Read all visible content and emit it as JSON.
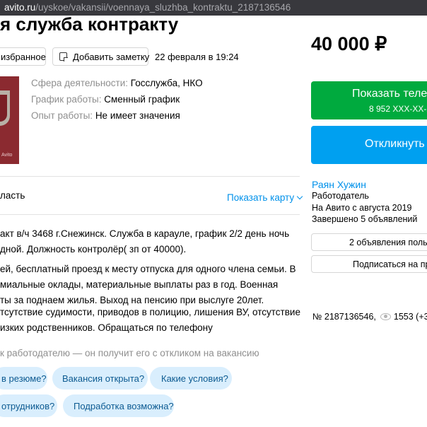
{
  "browser": {
    "url_host": "avito.ru",
    "url_path": "/uyskoe/vakansii/voennaya_sluzhba_kontraktu_2187136546"
  },
  "listing": {
    "title": "я служба контракту",
    "price": "40 000 ₽",
    "favorite_label": "избранное",
    "note_label": "Добавить заметку",
    "posted": "22 февраля в 19:24",
    "photo_watermark": "Avito"
  },
  "params": [
    {
      "key": "Сфера деятельности:",
      "value": "Госслужба, НКО"
    },
    {
      "key": "График работы:",
      "value": "Сменный график"
    },
    {
      "key": "Опыт работы:",
      "value": "Не имеет значения"
    }
  ],
  "location": {
    "region": "ласть",
    "map_link": "Показать карту"
  },
  "description": [
    "акт в/ч 3468 г.Снежинск. Служба в карауле, график 2/2 день ночь",
    "дной. Должность контролёр( зп от 40000).",
    "ей, бесплатный проезд к месту отпуска для одного члена семьи. В",
    "миальные оклады, материальные выплаты раз в год. Военная",
    "ты за поднаем жилья. Выход на пенсию при выслуге 20лет.",
    "тсутствие судимости, приводов в полицию, лишения ВУ, отсутствие",
    "изких родственников. Обращаться по телефону"
  ],
  "questions": {
    "hint": "к работодателю — он получит его с откликом на вакансию",
    "chips": [
      "в резюме?",
      "Вакансия открыта?",
      "Какие условия?",
      "отрудников?",
      "Подработка возможна?"
    ]
  },
  "sidebar": {
    "call_label": "Показать теле",
    "call_phone": "8 952 XXX-XX-Х",
    "respond_label": "Откликнуть",
    "seller_name": "Раян Хужин",
    "seller_lines": [
      "Работодатель",
      "На Авито с августа 2019",
      "Завершено 5 объявлений"
    ],
    "more_ads_label": "2 объявления пользо",
    "subscribe_label": "Подписаться на про",
    "ad_number": "№ 2187136546,",
    "views": "1553 (+3)"
  },
  "colors": {
    "green": "#00aa3e",
    "blue": "#00a0f0",
    "link": "#0091ea",
    "chip_bg": "#d9eefd"
  }
}
